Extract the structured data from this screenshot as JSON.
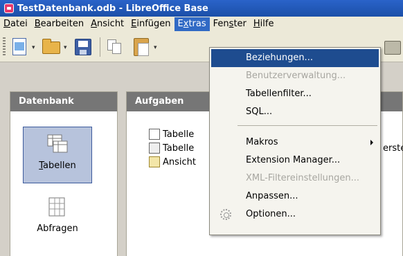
{
  "window": {
    "title": "TestDatenbank.odb - LibreOffice Base"
  },
  "menubar": {
    "items": [
      {
        "label": "Datei",
        "key": "D"
      },
      {
        "label": "Bearbeiten",
        "key": "B"
      },
      {
        "label": "Ansicht",
        "key": "A"
      },
      {
        "label": "Einfügen",
        "key": "E"
      },
      {
        "label": "Extras",
        "key": "x"
      },
      {
        "label": "Fenster",
        "key": "s"
      },
      {
        "label": "Hilfe",
        "key": "H"
      }
    ],
    "active": "Extras"
  },
  "extras_menu": {
    "items": [
      {
        "label": "Beziehungen...",
        "state": "highlighted"
      },
      {
        "label": "Benutzerverwaltung...",
        "state": "disabled"
      },
      {
        "label": "Tabellenfilter...",
        "state": "enabled"
      },
      {
        "label": "SQL...",
        "state": "enabled"
      },
      {
        "label": "Makros",
        "state": "enabled",
        "submenu": true
      },
      {
        "label": "Extension Manager...",
        "state": "enabled"
      },
      {
        "label": "XML-Filtereinstellungen...",
        "state": "disabled"
      },
      {
        "label": "Anpassen...",
        "state": "enabled"
      },
      {
        "label": "Optionen...",
        "state": "enabled",
        "icon": "gear-icon"
      }
    ]
  },
  "database_panel": {
    "header": "Datenbank",
    "items": [
      {
        "label": "Tabellen",
        "selected": true,
        "icon": "tables-icon"
      },
      {
        "label": "Abfragen",
        "selected": false,
        "icon": "queries-icon"
      }
    ]
  },
  "tasks_panel": {
    "header": "Aufgaben",
    "tasks": [
      {
        "label": "Tabelle",
        "icon": "table-design-icon"
      },
      {
        "label": "Tabelle",
        "icon": "table-wizard-icon"
      },
      {
        "label": "Ansicht",
        "icon": "view-icon"
      }
    ],
    "description_fragment": "erstel"
  },
  "colors": {
    "titlebar": "#1b4fa8",
    "menu_highlight": "#1e4c8f",
    "panel_header": "#767676",
    "selected_item": "#b7c3dc"
  }
}
